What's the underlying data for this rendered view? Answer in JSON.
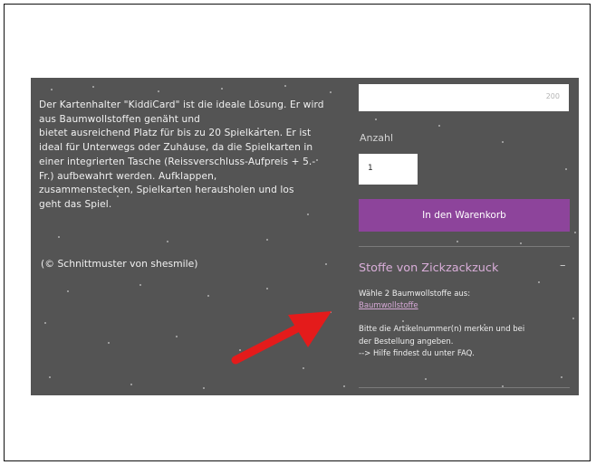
{
  "description": {
    "lines": [
      "Der Kartenhalter \"KiddiCard\" ist die ideale Lösung. Er wird",
      "aus Baumwollstoffen genäht und",
      "bietet ausreichend Platz für bis zu 20 Spielkarten. Er ist",
      "ideal für Unterwegs oder Zuhause, da die Spielkarten in",
      "einer integrierten Tasche (Reissverschluss-Aufpreis + 5.-",
      "Fr.) aufbewahrt werden. Aufklappen,",
      "zusammenstecken, Spielkarten herausholen und los",
      "geht das Spiel."
    ],
    "credit": "(© Schnittmuster von shesmile)"
  },
  "order": {
    "price_value": "200",
    "quantity_label": "Anzahl",
    "quantity_value": "1",
    "cart_button": "In den Warenkorb"
  },
  "fabric_section": {
    "title": "Stoffe von Zickzackzuck",
    "collapse_symbol": "–",
    "choose_text": "Wähle 2 Baumwollstoffe aus:",
    "link_text": "Baumwollstoffe",
    "note_line1": "Bitte die Artikelnummer(n) merken und bei",
    "note_line2": "der Bestellung angeben.",
    "note_line3": "--> Hilfe findest du unter FAQ."
  },
  "colors": {
    "panel_bg": "#545454",
    "accent_button": "#8d449b",
    "section_title": "#d9aed9",
    "annotation_arrow": "#e41b1b"
  },
  "icons": {
    "annotation": "red-arrow-icon"
  }
}
